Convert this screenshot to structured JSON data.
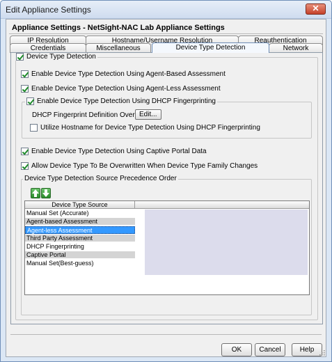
{
  "window": {
    "title": "Edit Appliance Settings",
    "close_glyph": "✕"
  },
  "header": {
    "title": "Appliance Settings - NetSight-NAC Lab Appliance Settings"
  },
  "tabs": {
    "row1": [
      "IP Resolution",
      "Hostname/Username Resolution",
      "Reauthentication"
    ],
    "row2": [
      "Credentials",
      "Miscellaneous",
      "Device Type Detection",
      "Network"
    ],
    "active": "Device Type Detection"
  },
  "options": {
    "device_type_detection": {
      "label": "Device Type Detection",
      "checked": true
    },
    "agent_based": {
      "label": "Enable Device Type Detection Using Agent-Based Assessment",
      "checked": true
    },
    "agent_less": {
      "label": "Enable Device Type Detection Using Agent-Less Assessment",
      "checked": true
    },
    "dhcp": {
      "label": "Enable Device Type Detection Using DHCP Fingerprinting",
      "checked": true
    },
    "dhcp_overrides_label": "DHCP Fingerprint Definition Overrides:",
    "dhcp_overrides_button": "Edit...",
    "hostname_dhcp": {
      "label": "Utilize Hostname for Device Type Detection Using DHCP Fingerprinting",
      "checked": false
    },
    "captive_portal": {
      "label": "Enable Device Type Detection Using Captive Portal Data",
      "checked": true
    },
    "allow_overwrite": {
      "label": "Allow Device Type To Be Overwritten When Device Type Family Changes",
      "checked": true
    }
  },
  "precedence": {
    "title": "Device Type Detection Source Precedence Order",
    "up_icon": "arrow-up-icon",
    "down_icon": "arrow-down-icon",
    "column_header": "Device Type Source",
    "rows": [
      "Manual Set (Accurate)",
      "Agent-based Assessment",
      "Agent-less Assessment",
      "Third Party Assessment",
      "DHCP Fingerprinting",
      "Captive Portal",
      "Manual Set(Best-guess)"
    ],
    "selected": "Agent-less Assessment"
  },
  "buttons": {
    "ok": "OK",
    "cancel": "Cancel",
    "help": "Help"
  },
  "colors": {
    "selection": "#3399ff",
    "check": "#1e8a2a",
    "window_frame": "#dbe7f5"
  }
}
